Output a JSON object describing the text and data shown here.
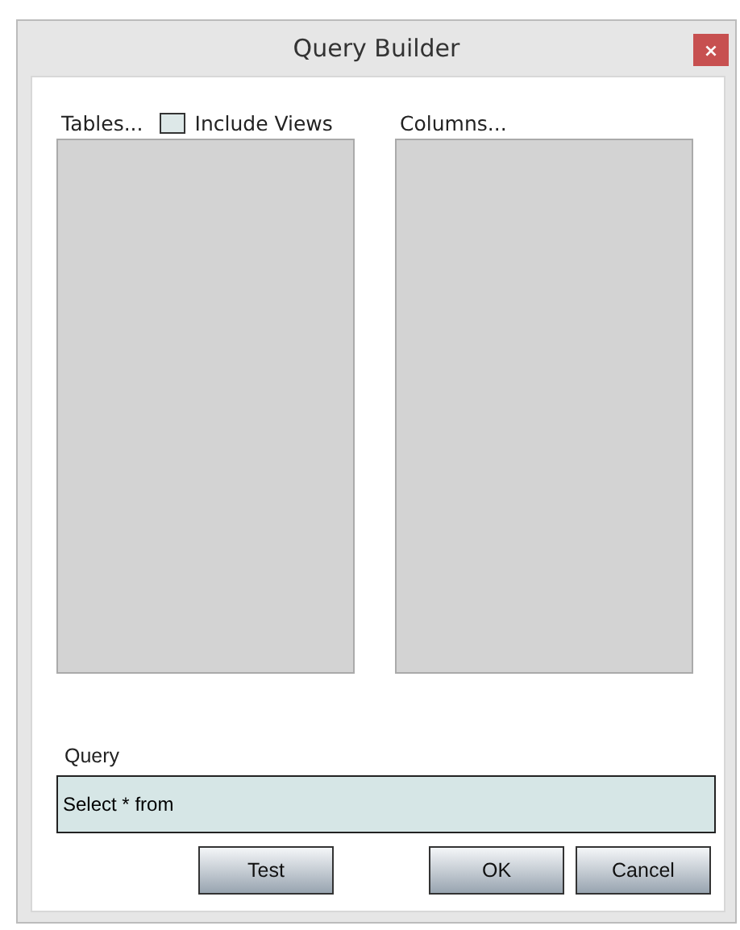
{
  "window": {
    "title": "Query Builder",
    "close": "×"
  },
  "tables": {
    "label": "Tables...",
    "include_views": {
      "label": "Include Views",
      "checked": false
    }
  },
  "columns": {
    "label": "Columns..."
  },
  "query": {
    "label": "Query",
    "value": "Select * from"
  },
  "buttons": [
    "Test",
    "OK",
    "Cancel"
  ]
}
